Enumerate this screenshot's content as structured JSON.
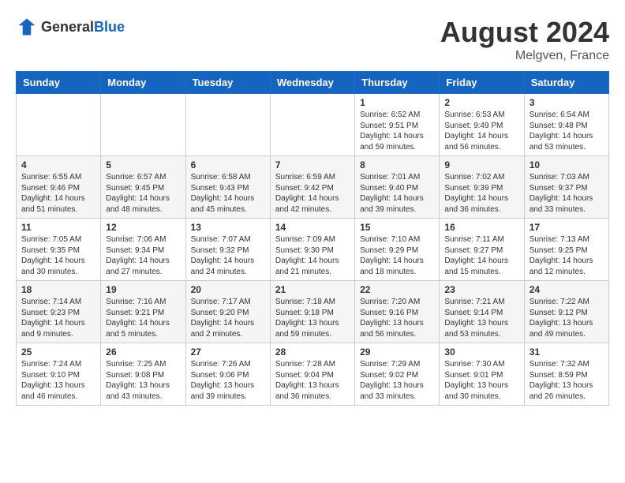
{
  "header": {
    "logo_general": "General",
    "logo_blue": "Blue",
    "month_year": "August 2024",
    "location": "Melgven, France"
  },
  "weekdays": [
    "Sunday",
    "Monday",
    "Tuesday",
    "Wednesday",
    "Thursday",
    "Friday",
    "Saturday"
  ],
  "weeks": [
    [
      {
        "day": "",
        "info": ""
      },
      {
        "day": "",
        "info": ""
      },
      {
        "day": "",
        "info": ""
      },
      {
        "day": "",
        "info": ""
      },
      {
        "day": "1",
        "info": "Sunrise: 6:52 AM\nSunset: 9:51 PM\nDaylight: 14 hours\nand 59 minutes."
      },
      {
        "day": "2",
        "info": "Sunrise: 6:53 AM\nSunset: 9:49 PM\nDaylight: 14 hours\nand 56 minutes."
      },
      {
        "day": "3",
        "info": "Sunrise: 6:54 AM\nSunset: 9:48 PM\nDaylight: 14 hours\nand 53 minutes."
      }
    ],
    [
      {
        "day": "4",
        "info": "Sunrise: 6:55 AM\nSunset: 9:46 PM\nDaylight: 14 hours\nand 51 minutes."
      },
      {
        "day": "5",
        "info": "Sunrise: 6:57 AM\nSunset: 9:45 PM\nDaylight: 14 hours\nand 48 minutes."
      },
      {
        "day": "6",
        "info": "Sunrise: 6:58 AM\nSunset: 9:43 PM\nDaylight: 14 hours\nand 45 minutes."
      },
      {
        "day": "7",
        "info": "Sunrise: 6:59 AM\nSunset: 9:42 PM\nDaylight: 14 hours\nand 42 minutes."
      },
      {
        "day": "8",
        "info": "Sunrise: 7:01 AM\nSunset: 9:40 PM\nDaylight: 14 hours\nand 39 minutes."
      },
      {
        "day": "9",
        "info": "Sunrise: 7:02 AM\nSunset: 9:39 PM\nDaylight: 14 hours\nand 36 minutes."
      },
      {
        "day": "10",
        "info": "Sunrise: 7:03 AM\nSunset: 9:37 PM\nDaylight: 14 hours\nand 33 minutes."
      }
    ],
    [
      {
        "day": "11",
        "info": "Sunrise: 7:05 AM\nSunset: 9:35 PM\nDaylight: 14 hours\nand 30 minutes."
      },
      {
        "day": "12",
        "info": "Sunrise: 7:06 AM\nSunset: 9:34 PM\nDaylight: 14 hours\nand 27 minutes."
      },
      {
        "day": "13",
        "info": "Sunrise: 7:07 AM\nSunset: 9:32 PM\nDaylight: 14 hours\nand 24 minutes."
      },
      {
        "day": "14",
        "info": "Sunrise: 7:09 AM\nSunset: 9:30 PM\nDaylight: 14 hours\nand 21 minutes."
      },
      {
        "day": "15",
        "info": "Sunrise: 7:10 AM\nSunset: 9:29 PM\nDaylight: 14 hours\nand 18 minutes."
      },
      {
        "day": "16",
        "info": "Sunrise: 7:11 AM\nSunset: 9:27 PM\nDaylight: 14 hours\nand 15 minutes."
      },
      {
        "day": "17",
        "info": "Sunrise: 7:13 AM\nSunset: 9:25 PM\nDaylight: 14 hours\nand 12 minutes."
      }
    ],
    [
      {
        "day": "18",
        "info": "Sunrise: 7:14 AM\nSunset: 9:23 PM\nDaylight: 14 hours\nand 9 minutes."
      },
      {
        "day": "19",
        "info": "Sunrise: 7:16 AM\nSunset: 9:21 PM\nDaylight: 14 hours\nand 5 minutes."
      },
      {
        "day": "20",
        "info": "Sunrise: 7:17 AM\nSunset: 9:20 PM\nDaylight: 14 hours\nand 2 minutes."
      },
      {
        "day": "21",
        "info": "Sunrise: 7:18 AM\nSunset: 9:18 PM\nDaylight: 13 hours\nand 59 minutes."
      },
      {
        "day": "22",
        "info": "Sunrise: 7:20 AM\nSunset: 9:16 PM\nDaylight: 13 hours\nand 56 minutes."
      },
      {
        "day": "23",
        "info": "Sunrise: 7:21 AM\nSunset: 9:14 PM\nDaylight: 13 hours\nand 53 minutes."
      },
      {
        "day": "24",
        "info": "Sunrise: 7:22 AM\nSunset: 9:12 PM\nDaylight: 13 hours\nand 49 minutes."
      }
    ],
    [
      {
        "day": "25",
        "info": "Sunrise: 7:24 AM\nSunset: 9:10 PM\nDaylight: 13 hours\nand 46 minutes."
      },
      {
        "day": "26",
        "info": "Sunrise: 7:25 AM\nSunset: 9:08 PM\nDaylight: 13 hours\nand 43 minutes."
      },
      {
        "day": "27",
        "info": "Sunrise: 7:26 AM\nSunset: 9:06 PM\nDaylight: 13 hours\nand 39 minutes."
      },
      {
        "day": "28",
        "info": "Sunrise: 7:28 AM\nSunset: 9:04 PM\nDaylight: 13 hours\nand 36 minutes."
      },
      {
        "day": "29",
        "info": "Sunrise: 7:29 AM\nSunset: 9:02 PM\nDaylight: 13 hours\nand 33 minutes."
      },
      {
        "day": "30",
        "info": "Sunrise: 7:30 AM\nSunset: 9:01 PM\nDaylight: 13 hours\nand 30 minutes."
      },
      {
        "day": "31",
        "info": "Sunrise: 7:32 AM\nSunset: 8:59 PM\nDaylight: 13 hours\nand 26 minutes."
      }
    ]
  ]
}
